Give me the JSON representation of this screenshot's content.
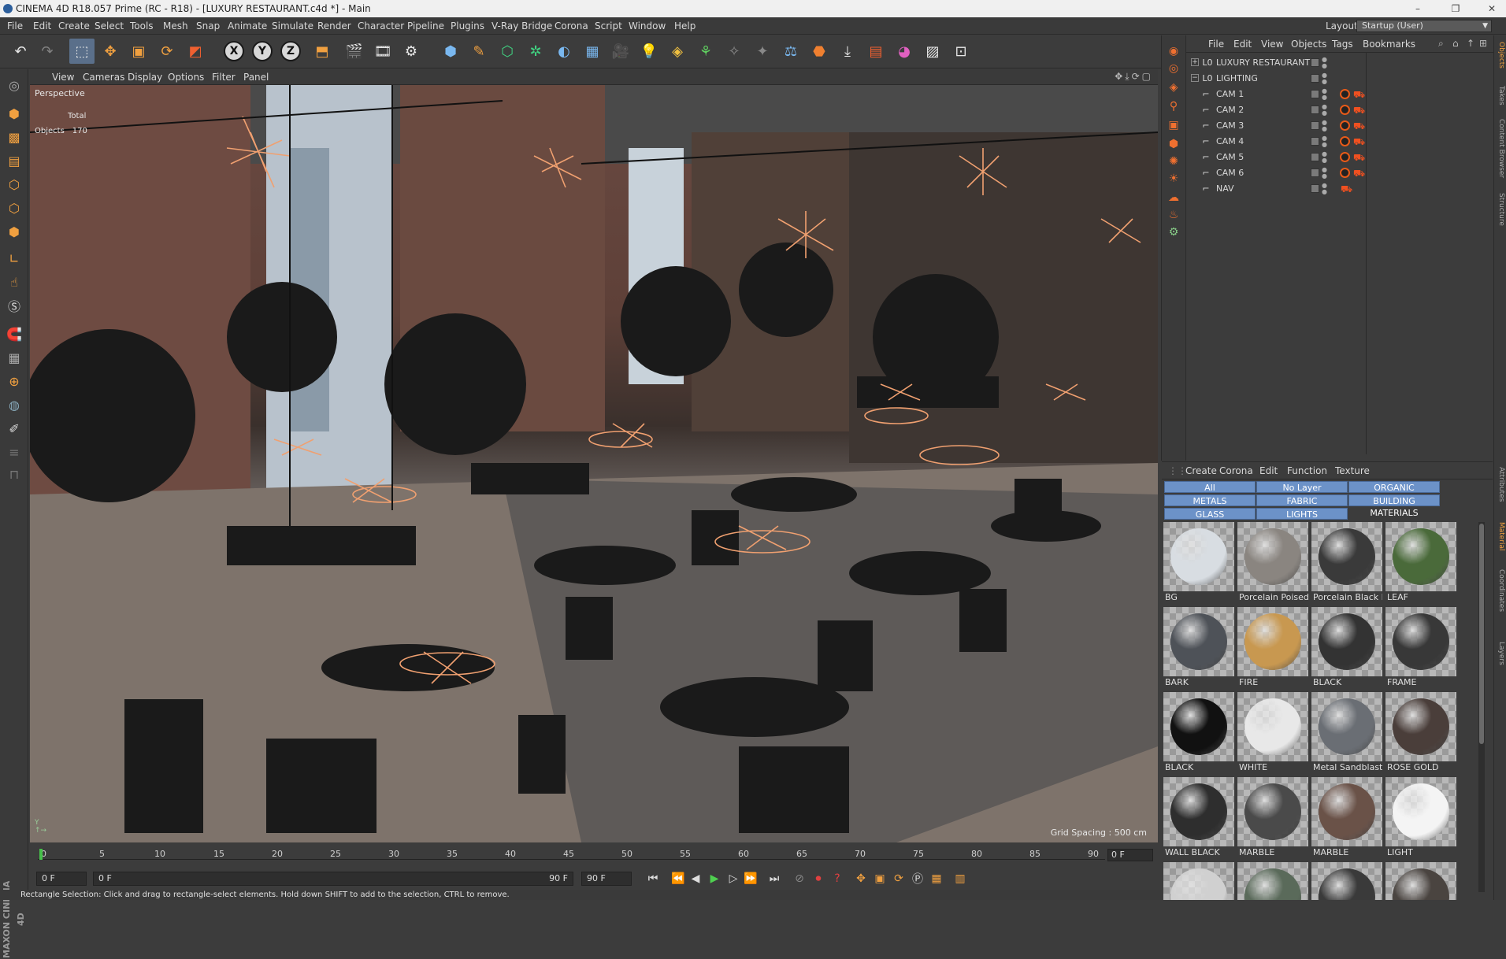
{
  "window": {
    "title": "CINEMA 4D R18.057 Prime (RC - R18) - [LUXURY RESTAURANT.c4d *] - Main",
    "controls": [
      "–",
      "❐",
      "✕"
    ]
  },
  "menubar": {
    "items": [
      "File",
      "Edit",
      "Create",
      "Select",
      "Tools",
      "Mesh",
      "Snap",
      "Animate",
      "Simulate",
      "Render",
      "Character",
      "Pipeline",
      "Plugins",
      "V-Ray Bridge",
      "Corona",
      "Script",
      "Window",
      "Help"
    ],
    "layout_label": "Layout:",
    "layout_value": "Startup (User)"
  },
  "toolbar": {
    "axis_x": "X",
    "axis_y": "Y",
    "axis_z": "Z"
  },
  "viewport": {
    "menu": [
      "View",
      "Cameras",
      "Display",
      "Options",
      "Filter",
      "Panel"
    ],
    "label": "Perspective",
    "stats_header": "Total",
    "stats_label": "Objects",
    "stats_value": "170",
    "grid_spacing": "Grid Spacing : 500 cm"
  },
  "timeline": {
    "ticks": [
      "0",
      "5",
      "10",
      "15",
      "20",
      "25",
      "30",
      "35",
      "40",
      "45",
      "50",
      "55",
      "60",
      "65",
      "70",
      "75",
      "80",
      "85",
      "90"
    ],
    "current_frame": "0 F"
  },
  "playbar": {
    "start_field": "0 F",
    "range_start": "0 F",
    "range_end": "90 F",
    "end_field": "90 F"
  },
  "status": "Rectangle Selection: Click and drag to rectangle-select elements. Hold down SHIFT to add to the selection, CTRL to remove.",
  "object_manager": {
    "menu": [
      "File",
      "Edit",
      "View",
      "Objects",
      "Tags",
      "Bookmarks"
    ],
    "objects": [
      {
        "name": "LUXURY RESTAURANT",
        "type": "layer",
        "depth": 0
      },
      {
        "name": "LIGHTING",
        "type": "layer",
        "depth": 0
      },
      {
        "name": "CAM 1",
        "type": "camera",
        "depth": 1
      },
      {
        "name": "CAM 2",
        "type": "camera",
        "depth": 1
      },
      {
        "name": "CAM 3",
        "type": "camera",
        "depth": 1
      },
      {
        "name": "CAM 4",
        "type": "camera",
        "depth": 1
      },
      {
        "name": "CAM 5",
        "type": "camera",
        "depth": 1
      },
      {
        "name": "CAM 6",
        "type": "camera",
        "depth": 1
      },
      {
        "name": "NAV",
        "type": "camera",
        "depth": 1
      }
    ]
  },
  "side_tabs": [
    "Objects",
    "Takes",
    "Content Browser",
    "Structure",
    "Attributes",
    "Material",
    "Coordinates",
    "Layers"
  ],
  "material_manager": {
    "menu": [
      "Create",
      "Corona",
      "Edit",
      "Function",
      "Texture"
    ],
    "layers": [
      "All",
      "No Layer",
      "ORGANIC",
      "METALS",
      "FABRIC",
      "BUILDING MATERIALS",
      "GLASS",
      "LIGHTS"
    ],
    "materials": [
      {
        "name": "BG",
        "color": "#d8dde2"
      },
      {
        "name": "Porcelain Poised",
        "color": "#8a8580"
      },
      {
        "name": "Porcelain Black M",
        "color": "#3a3a3a"
      },
      {
        "name": "LEAF",
        "color": "#4a6a3a"
      },
      {
        "name": "BARK",
        "color": "#4e5258"
      },
      {
        "name": "FIRE",
        "color": "#c89850"
      },
      {
        "name": "BLACK",
        "color": "#333333"
      },
      {
        "name": "FRAME",
        "color": "#383838"
      },
      {
        "name": "BLACK",
        "color": "#111111"
      },
      {
        "name": "WHITE",
        "color": "#e8e8e8"
      },
      {
        "name": "Metal Sandblaste",
        "color": "#6a6e74"
      },
      {
        "name": "ROSE GOLD",
        "color": "#4a3e3a"
      },
      {
        "name": "WALL BLACK",
        "color": "#2e2e2e"
      },
      {
        "name": "MARBLE",
        "color": "#4a4a4a"
      },
      {
        "name": "MARBLE",
        "color": "#6a5248"
      },
      {
        "name": "LIGHT",
        "color": "#f4f4f4"
      }
    ]
  }
}
